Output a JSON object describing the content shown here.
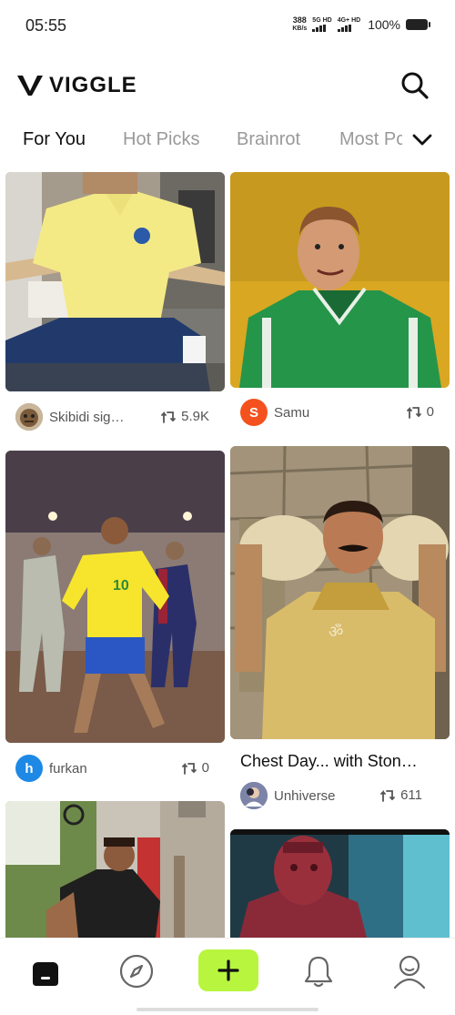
{
  "status_bar": {
    "time": "05:55",
    "net_speed_value": "388",
    "net_speed_unit": "KB/s",
    "sim1_label": "5G HD",
    "sim2_label": "4G+ HD",
    "battery": "100%"
  },
  "header": {
    "logo_text": "VIGGLE",
    "search_icon": "search-icon"
  },
  "tabs": [
    {
      "label": "For You",
      "active": true
    },
    {
      "label": "Hot Picks",
      "active": false
    },
    {
      "label": "Brainrot",
      "active": false
    },
    {
      "label": "Most Pc",
      "active": false
    }
  ],
  "tabs_more_icon": "chevron-down-icon",
  "feed": {
    "left": [
      {
        "author": "Skibidi sig…",
        "remixes": "5.9K",
        "avatar_type": "image",
        "avatar_color": "#8a6d4a"
      },
      {
        "author": "furkan",
        "remixes": "0",
        "avatar_type": "letter",
        "avatar_letter": "h",
        "avatar_color": "#1e88e5"
      },
      {
        "author": "",
        "remixes": ""
      }
    ],
    "right": [
      {
        "author": "Samu",
        "remixes": "0",
        "avatar_type": "letter",
        "avatar_letter": "S",
        "avatar_color": "#f4511e"
      },
      {
        "title": "Chest Day... with Ston…",
        "author": "Unhiverse",
        "remixes": "611",
        "avatar_type": "image",
        "avatar_color": "#6b6f8a"
      },
      {
        "author": "",
        "remixes": ""
      }
    ]
  },
  "bottom_nav": {
    "items": [
      "home-icon",
      "explore-icon",
      "create-icon",
      "notifications-icon",
      "profile-icon"
    ],
    "accent": "#b8f53f"
  }
}
